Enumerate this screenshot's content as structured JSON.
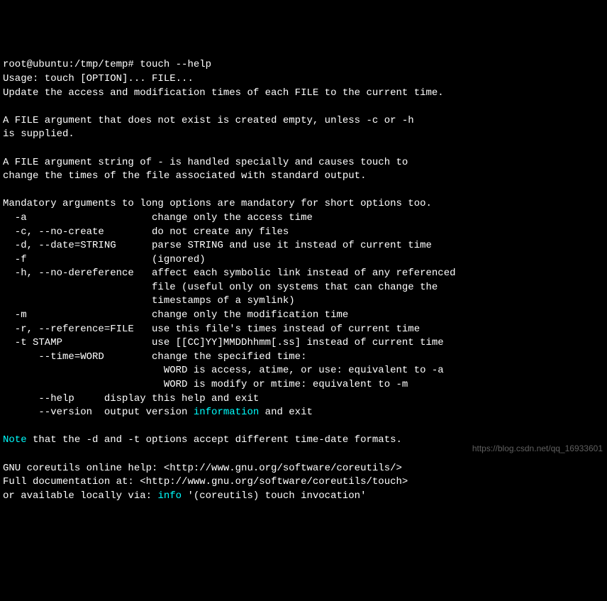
{
  "terminal": {
    "prompt": "root@ubuntu:/tmp/temp# ",
    "command": "touch --help",
    "usage_line": "Usage: touch [OPTION]... FILE...",
    "desc_line": "Update the access and modification times of each FILE to the current time.",
    "para2_line1": "A FILE argument that does not exist is created empty, unless -c or -h",
    "para2_line2": "is supplied.",
    "para3_line1": "A FILE argument string of - is handled specially and causes touch to",
    "para3_line2": "change the times of the file associated with standard output.",
    "mandatory_line": "Mandatory arguments to long options are mandatory for short options too.",
    "opt_a": "  -a                     change only the access time",
    "opt_c": "  -c, --no-create        do not create any files",
    "opt_d": "  -d, --date=STRING      parse STRING and use it instead of current time",
    "opt_f": "  -f                     (ignored)",
    "opt_h1": "  -h, --no-dereference   affect each symbolic link instead of any referenced",
    "opt_h2": "                         file (useful only on systems that can change the",
    "opt_h3": "                         timestamps of a symlink)",
    "opt_m": "  -m                     change only the modification time",
    "opt_r": "  -r, --reference=FILE   use this file's times instead of current time",
    "opt_t": "  -t STAMP               use [[CC]YY]MMDDhhmm[.ss] instead of current time",
    "opt_time1": "      --time=WORD        change the specified time:",
    "opt_time2": "                           WORD is access, atime, or use: equivalent to -a",
    "opt_time3": "                           WORD is modify or mtime: equivalent to -m",
    "opt_help": "      --help     display this help and exit",
    "opt_version_pre": "      --version  output version ",
    "opt_version_info": "information",
    "opt_version_post": " and exit",
    "note_word": "Note",
    "note_rest": " that the -d and -t options accept different time-date formats.",
    "gnu_help": "GNU coreutils online help: <http://www.gnu.org/software/coreutils/>",
    "full_doc": "Full documentation at: <http://www.gnu.org/software/coreutils/touch>",
    "local_pre": "or available locally via: ",
    "local_info": "info",
    "local_post": " '(coreutils) touch invocation'"
  },
  "watermark": "https://blog.csdn.net/qq_16933601"
}
